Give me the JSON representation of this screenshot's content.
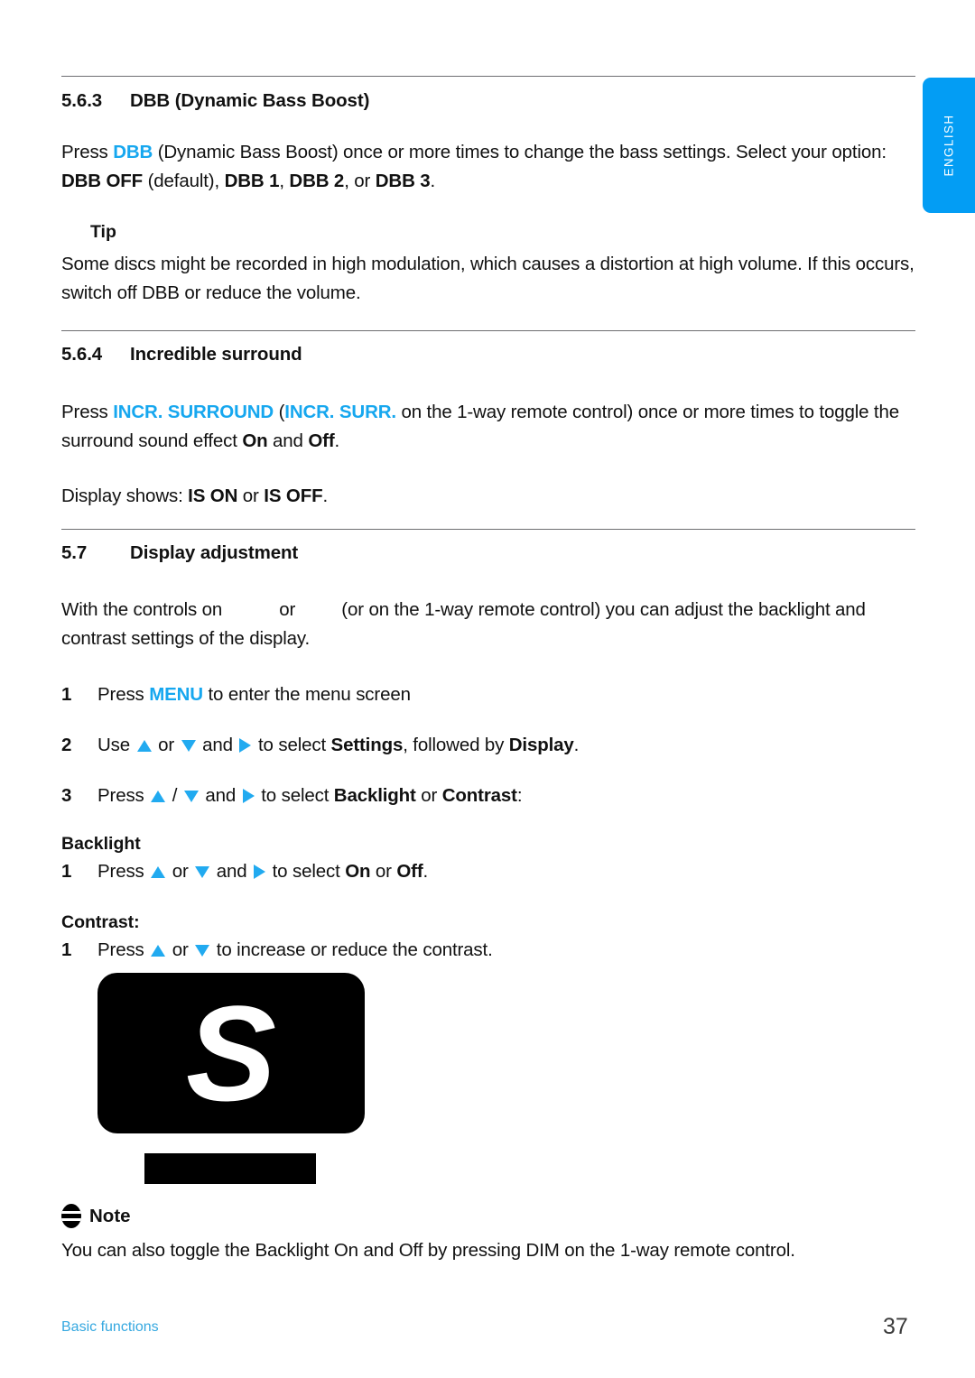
{
  "sidebar": {
    "language_tab": "ENGLISH"
  },
  "sections": {
    "dbb": {
      "number": "5.6.3",
      "title": "DBB (Dynamic Bass Boost)",
      "para_lead": "Press ",
      "keyword": "DBB",
      "para_mid": " (Dynamic Bass Boost) once or more times to change the bass settings. Select your option: ",
      "opt1": "DBB OFF",
      "opt1_suffix": " (default), ",
      "opt2": "DBB 1",
      "opt2_suffix": ", ",
      "opt3": "DBB 2",
      "opt3_suffix": ", or ",
      "opt4": "DBB 3",
      "opt4_suffix": "."
    },
    "tip": {
      "label": "Tip",
      "text": "Some discs might be recorded in high modulation, which causes a distortion at high volume. If this occurs, switch off DBB or reduce the volume."
    },
    "surround": {
      "number": "5.6.4",
      "title": "Incredible surround",
      "lead": "Press ",
      "key1": "INCR. SURROUND",
      "mid1": " (",
      "key2": "INCR. SURR.",
      "mid2": " on the 1-way remote control) once or more times to toggle the surround sound effect ",
      "on": "On",
      "and": " and ",
      "off": "Off",
      "end": ".",
      "display_lead": "Display shows: ",
      "display_on": "IS ON",
      "display_or": " or ",
      "display_off": "IS OFF",
      "display_end": "."
    },
    "display_adjustment": {
      "number": "5.7",
      "title": "Display adjustment",
      "intro_a": "With the controls on ",
      "intro_or": " or ",
      "intro_b": " (or on the 1-way remote control) you can adjust the backlight and contrast settings of the display.",
      "steps": [
        {
          "index": "1",
          "lead": "Press ",
          "key": "MENU",
          "tail": " to enter the menu screen"
        },
        {
          "index": "2",
          "lead": "Use ",
          "or": " or ",
          "and": " and ",
          "mid": " to select ",
          "bold1": "Settings",
          "sep": ", followed by ",
          "bold2": "Display",
          "end": "."
        },
        {
          "index": "3",
          "lead": "Press ",
          "slash": " / ",
          "and": " and ",
          "mid": " to select ",
          "bold1": "Backlight",
          "sep": " or ",
          "bold2": "Contrast",
          "end": ":"
        }
      ],
      "backlight": {
        "heading": "Backlight",
        "index": "1",
        "lead": "Press ",
        "or": " or ",
        "and": " and ",
        "mid": " to select ",
        "bold1": "On",
        "sep": " or ",
        "bold2": "Off",
        "end": "."
      },
      "contrast": {
        "heading": "Contrast:",
        "index": "1",
        "lead": "Press ",
        "or": " or ",
        "tail": " to increase or reduce the contrast."
      }
    },
    "illustration": {
      "screen_letter": "S"
    },
    "note": {
      "label": "Note",
      "text": "You can also toggle the Backlight On and Off by pressing DIM on the 1-way remote control."
    }
  },
  "footer": {
    "chapter": "Basic functions",
    "page": "37"
  },
  "colors": {
    "accent_blue": "#16A7EF",
    "tab_blue": "#039DF4",
    "arrow_blue": "#21AAF0",
    "footer_blue": "#35A8E0"
  }
}
